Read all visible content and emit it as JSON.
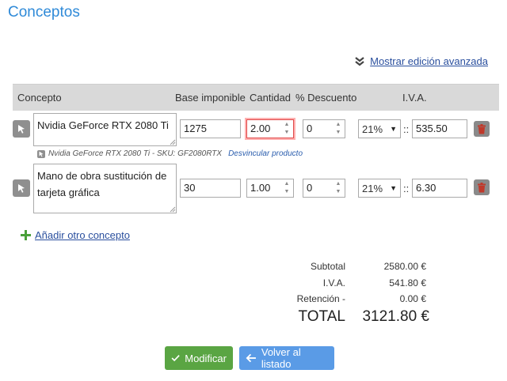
{
  "page": {
    "title": "Conceptos"
  },
  "advanced": {
    "label": "Mostrar edición avanzada"
  },
  "table": {
    "headers": {
      "concepto": "Concepto",
      "base": "Base imponible",
      "cantidad": "Cantidad",
      "descuento": "% Descuento",
      "iva": "I.V.A."
    },
    "rows": [
      {
        "concepto": "Nvidia GeForce RTX 2080 Ti",
        "base": "1275",
        "cantidad": "2.00",
        "descuento": "0",
        "iva_rate": "21%",
        "separator": "::",
        "iva_amount": "535.50",
        "sku_text": "Nvidia GeForce RTX 2080 Ti - SKU: GF2080RTX",
        "unlink_label": "Desvincular producto"
      },
      {
        "concepto": "Mano de obra sustitución de tarjeta gráfica",
        "base": "30",
        "cantidad": "1.00",
        "descuento": "0",
        "iva_rate": "21%",
        "separator": "::",
        "iva_amount": "6.30"
      }
    ]
  },
  "add_concept": {
    "label": "Añadir otro concepto"
  },
  "totals": {
    "subtotal_label": "Subtotal",
    "subtotal_value": "2580.00 €",
    "iva_label": "I.V.A.",
    "iva_value": "541.80 €",
    "retencion_label": "Retención -",
    "retencion_value": "0.00 €",
    "total_label": "TOTAL",
    "total_value": "3121.80 €"
  },
  "buttons": {
    "modify": "Modificar",
    "back": "Volver al listado"
  },
  "colors": {
    "title": "#2f8ad8",
    "link": "#2a4f9e",
    "header_bg": "#d9d9d9",
    "error": "#e04a4a",
    "green": "#5aa543",
    "blue": "#5a9be6",
    "add_plus": "#4aa03a"
  },
  "icons": {
    "advanced": "double-chevron-down-icon",
    "row": "cursor-arrow-icon",
    "delete": "trash-icon",
    "add": "plus-icon",
    "modify": "check-icon",
    "back": "arrow-left-icon"
  }
}
